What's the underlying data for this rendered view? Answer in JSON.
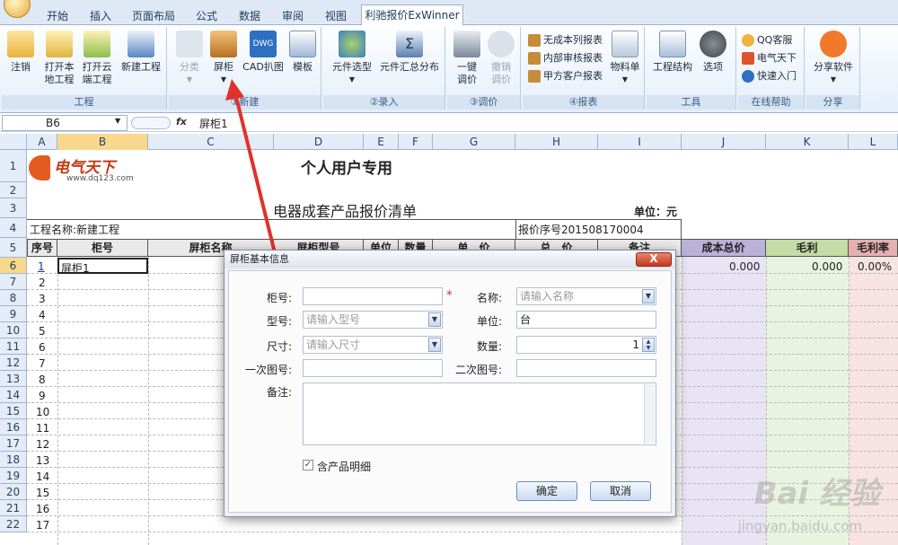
{
  "tabs": [
    "开始",
    "插入",
    "页面布局",
    "公式",
    "数据",
    "审阅",
    "视图",
    "利驰报价ExWinner"
  ],
  "active_tab": "利驰报价ExWinner",
  "ribbon": {
    "project": {
      "label": "工程",
      "buttons": [
        "注销",
        "打开本\n地工程",
        "打开云\n端工程",
        "新建工程"
      ]
    },
    "new": {
      "label": "①新建",
      "buttons": [
        "分类",
        "屏柜",
        "CAD扒图",
        "模板"
      ]
    },
    "entry": {
      "label": "②录入",
      "buttons": [
        "元件选型",
        "元件汇总分布"
      ]
    },
    "price": {
      "label": "③调价",
      "buttons": [
        "一键\n调价",
        "撤销\n调价"
      ]
    },
    "report": {
      "label": "④报表",
      "small": [
        "无成本列报表",
        "内部审核报表",
        "甲方客户报表"
      ],
      "buttons": [
        "物料单"
      ]
    },
    "tools": {
      "label": "工具",
      "buttons": [
        "工程结构",
        "选项"
      ]
    },
    "help": {
      "label": "在线帮助",
      "small": [
        "QQ客服",
        "电气天下",
        "快速入门"
      ]
    },
    "share": {
      "label": "分享",
      "buttons": [
        "分享软件"
      ]
    }
  },
  "formula_bar": {
    "name_box": "B6",
    "fx": "fx",
    "value": "屏柜1"
  },
  "columns": [
    "A",
    "B",
    "C",
    "D",
    "E",
    "F",
    "G",
    "H",
    "I",
    "J",
    "K",
    "L"
  ],
  "rows": [
    "1",
    "2",
    "3",
    "4",
    "5",
    "6",
    "7",
    "8",
    "9",
    "10",
    "11",
    "12",
    "13",
    "14",
    "15",
    "16",
    "17",
    "18",
    "19",
    "20",
    "21",
    "22"
  ],
  "sheet": {
    "logo_text": "电气天下",
    "logo_url": "www.dq123.com",
    "title": "个人用户专用",
    "subtitle": "电器成套产品报价清单",
    "unit": "单位：元",
    "project_name": "工程名称:新建工程",
    "quote_no": "报价序号201508170004",
    "headers": [
      "序号",
      "柜号",
      "屏柜名称",
      "屏柜型号",
      "单位",
      "数量",
      "单　价",
      "总　价",
      "备注",
      "成本总价",
      "毛利",
      "毛利率"
    ],
    "row_numbers": [
      "1",
      "2",
      "3",
      "4",
      "5",
      "6",
      "7",
      "8",
      "9",
      "10",
      "11",
      "12",
      "13",
      "14",
      "15",
      "16",
      "17"
    ],
    "first_row": {
      "cabinet": "屏柜1",
      "cost": "0.000",
      "profit": "0.000",
      "rate": "0.00%"
    }
  },
  "dialog": {
    "title": "屏柜基本信息",
    "close": "X",
    "fields": {
      "cabinet_no": "柜号:",
      "name": "名称:",
      "name_ph": "请输入名称",
      "model": "型号:",
      "model_ph": "请输入型号",
      "unit": "单位:",
      "unit_val": "台",
      "size": "尺寸:",
      "size_ph": "请输入尺寸",
      "qty": "数量:",
      "qty_val": "1",
      "drawing1": "一次图号:",
      "drawing2": "二次图号:",
      "remark": "备注:"
    },
    "checkbox": "含产品明细",
    "ok": "确定",
    "cancel": "取消"
  },
  "watermark": "Bai 经验",
  "watermark_url": "jingyan.baidu.com"
}
